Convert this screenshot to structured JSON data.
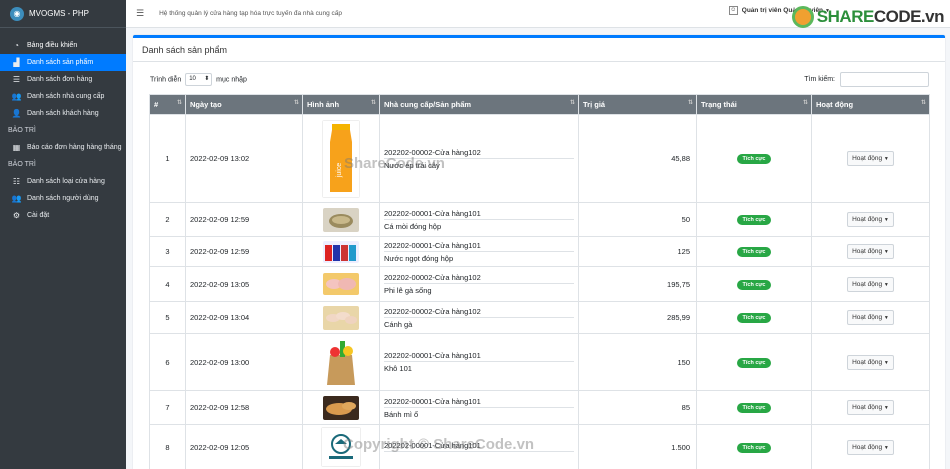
{
  "app": {
    "brand": "MVOGMS - PHP",
    "topbar_title": "Hệ thống quản lý cửa hàng tạp hóa trực tuyến đa nhà cung cấp",
    "user_label": "Quản trị viên Quản trị viên",
    "logo_text_a": "SHARE",
    "logo_text_b": "CODE.vn"
  },
  "sidebar": {
    "items": [
      {
        "label": "Bảng điều khiển",
        "icon": "dashboard-icon"
      },
      {
        "label": "Danh sách sản phẩm",
        "icon": "sitemap-icon"
      },
      {
        "label": "Danh sách đơn hàng",
        "icon": "list-icon"
      },
      {
        "label": "Danh sách nhà cung cấp",
        "icon": "users-icon"
      },
      {
        "label": "Danh sách khách hàng",
        "icon": "user-friends-icon"
      }
    ],
    "header_maintenance_1": "BẢO TRÌ",
    "report_item": "Báo cáo đơn hàng hàng tháng",
    "header_maintenance_2": "BẢO TRÌ",
    "maint_items": [
      {
        "label": "Danh sách loại cửa hàng",
        "icon": "th-list-icon"
      },
      {
        "label": "Danh sách người dùng",
        "icon": "users-cog-icon"
      },
      {
        "label": "Cài đặt",
        "icon": "cogs-icon"
      }
    ]
  },
  "card": {
    "title": "Danh sách sản phẩm",
    "show_prefix": "Trình diễn",
    "show_value": "10",
    "show_suffix": "mục nhập",
    "search_label": "Tìm kiếm:"
  },
  "table": {
    "headers": [
      "#",
      "Ngày tạo",
      "Hình ảnh",
      "Nhà cung cấp/Sản phẩm",
      "Trị giá",
      "Trạng thái",
      "Hoạt động"
    ],
    "rows": [
      {
        "no": "1",
        "date": "2022-02-09 13:02",
        "img": "juice",
        "vendor": "202202-00002-Cửa hàng102",
        "product": "Nước ép trái cây",
        "price": "45,88",
        "status": "Tích cực",
        "action": "Hoạt động"
      },
      {
        "no": "2",
        "date": "2022-02-09 12:59",
        "img": "sardine",
        "vendor": "202202-00001-Cửa hàng101",
        "product": "Cá mòi đóng hộp",
        "price": "50",
        "status": "Tích cực",
        "action": "Hoạt động"
      },
      {
        "no": "3",
        "date": "2022-02-09 12:59",
        "img": "cans",
        "vendor": "202202-00001-Cửa hàng101",
        "product": "Nước ngọt đóng hộp",
        "price": "125",
        "status": "Tích cực",
        "action": "Hoạt động"
      },
      {
        "no": "4",
        "date": "2022-02-09 13:05",
        "img": "chicken",
        "vendor": "202202-00002-Cửa hàng102",
        "product": "Phi lê gà sống",
        "price": "195,75",
        "status": "Tích cực",
        "action": "Hoạt động"
      },
      {
        "no": "5",
        "date": "2022-02-09 13:04",
        "img": "wings",
        "vendor": "202202-00002-Cửa hàng102",
        "product": "Cánh gà",
        "price": "285,99",
        "status": "Tích cực",
        "action": "Hoạt động"
      },
      {
        "no": "6",
        "date": "2022-02-09 13:00",
        "img": "grocery",
        "vendor": "202202-00001-Cửa hàng101",
        "product": "Khô 101",
        "price": "150",
        "status": "Tích cực",
        "action": "Hoạt động"
      },
      {
        "no": "7",
        "date": "2022-02-09 12:58",
        "img": "bread",
        "vendor": "202202-00001-Cửa hàng101",
        "product": "Bánh mì ổ",
        "price": "85",
        "status": "Tích cực",
        "action": "Hoạt động"
      },
      {
        "no": "8",
        "date": "2022-02-09 12:05",
        "img": "logo",
        "vendor": "202202-00001-Cửa hàng101",
        "product": "",
        "price": "1.500",
        "status": "Tích cực",
        "action": "Hoạt động"
      }
    ]
  },
  "watermarks": {
    "center": "ShareCode.vn",
    "bottom": "Copyright © ShareCode.vn"
  }
}
